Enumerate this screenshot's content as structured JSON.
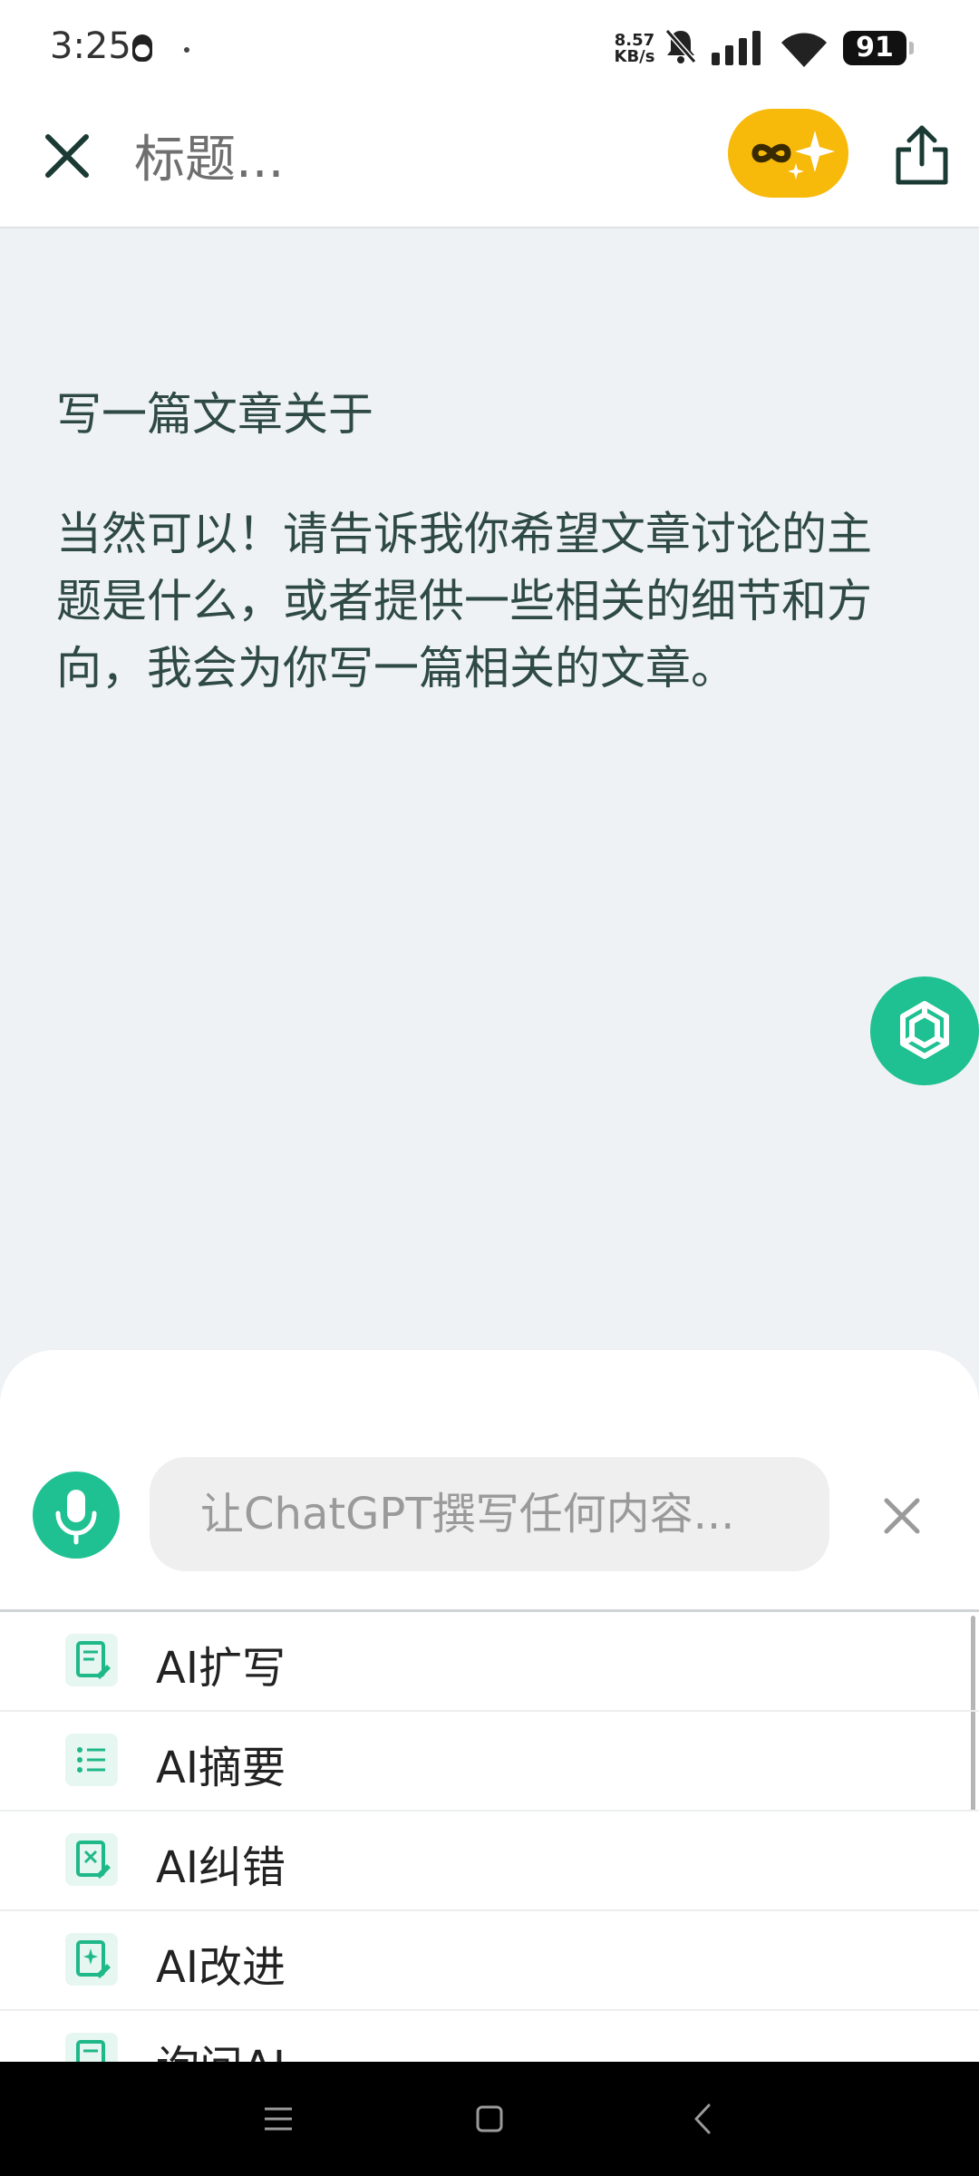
{
  "status_bar": {
    "time": "3:25",
    "net_speed_value": "8.57",
    "net_speed_unit": "KB/s",
    "battery": "91",
    "icons": [
      "qq-icon",
      "mute-icon",
      "signal-icon",
      "wifi-icon",
      "battery-icon"
    ]
  },
  "header": {
    "title": "标题...",
    "icons": [
      "close-icon",
      "premium-sparkle-icon",
      "share-icon"
    ]
  },
  "document": {
    "paragraphs": [
      "写一篇文章关于",
      "当然可以！请告诉我你希望文章讨论的主题是什么，或者提供一些相关的细节和方向，我会为你写一篇相关的文章。"
    ]
  },
  "assistant": {
    "placeholder": "让ChatGPT撰写任何内容...",
    "menu": [
      {
        "label": "AI扩写",
        "icon": "doc-pen-icon"
      },
      {
        "label": "AI摘要",
        "icon": "list-icon"
      },
      {
        "label": "AI纠错",
        "icon": "doc-x-icon"
      },
      {
        "label": "AI改进",
        "icon": "doc-sparkle-icon"
      },
      {
        "label": "询问AI",
        "icon": "doc-icon"
      }
    ]
  },
  "colors": {
    "accent": "#1fc091",
    "premium": "#f7b90a",
    "text": "#2f4a44",
    "background": "#eef2f5"
  }
}
